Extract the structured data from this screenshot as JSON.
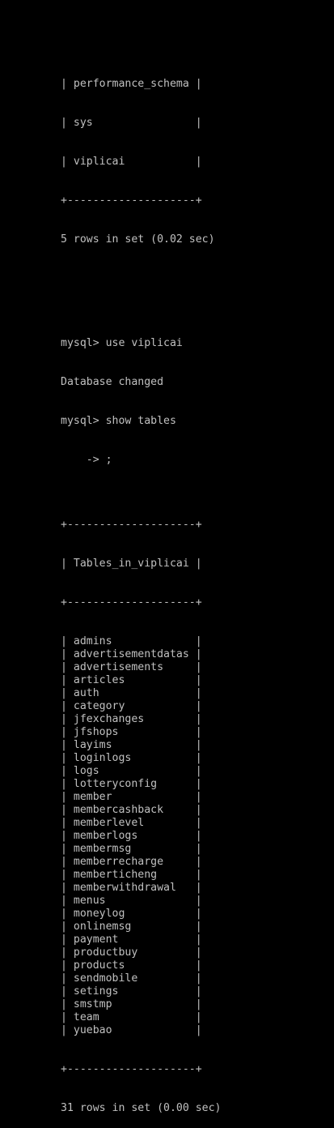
{
  "colors": {
    "background": "#000000",
    "text": "#c0c0c0"
  },
  "databases_tail": {
    "rows": [
      "| performance_schema |",
      "| sys                |",
      "| viplicai           |"
    ],
    "border": "+--------------------+",
    "summary": "5 rows in set (0.02 sec)"
  },
  "commands": {
    "use_cmd": "mysql> use viplicai",
    "use_result": "Database changed",
    "show_cmd": "mysql> show tables",
    "continuation": "    -> ;"
  },
  "tables_result": {
    "border": "+--------------------+",
    "header": "| Tables_in_viplicai |",
    "rows": [
      "| admins             |",
      "| advertisementdatas |",
      "| advertisements     |",
      "| articles           |",
      "| auth               |",
      "| category           |",
      "| jfexchanges        |",
      "| jfshops            |",
      "| layims             |",
      "| loginlogs          |",
      "| logs               |",
      "| lotteryconfig      |",
      "| member             |",
      "| membercashback     |",
      "| memberlevel        |",
      "| memberlogs         |",
      "| membermsg          |",
      "| memberrecharge     |",
      "| memberticheng      |",
      "| memberwithdrawal   |",
      "| menus              |",
      "| moneylog           |",
      "| onlinemsg          |",
      "| payment            |",
      "| productbuy         |",
      "| products           |",
      "| sendmobile         |",
      "| setings            |",
      "| smstmp             |",
      "| team               |",
      "| yuebao             |"
    ],
    "summary": "31 rows in set (0.00 sec)"
  }
}
